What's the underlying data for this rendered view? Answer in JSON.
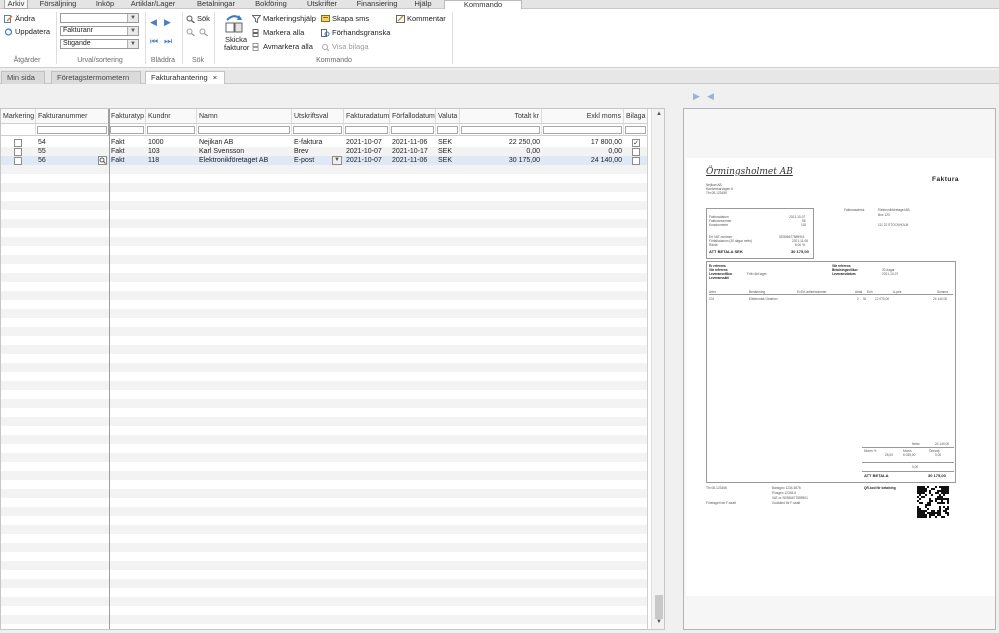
{
  "menu": {
    "tabs": [
      "Arkiv",
      "Försäljning",
      "Inköp",
      "Artiklar/Lager",
      "Betalningar",
      "Bokföring",
      "Utskrifter",
      "Finansiering",
      "Hjälp",
      "Kommando"
    ]
  },
  "ribbon": {
    "andra": "Ändra",
    "uppdatera": "Uppdatera",
    "atgarder_label": "Åtgärder",
    "combo_blank": "",
    "combo_sort": "Fakturanr",
    "combo_order": "Stigande",
    "urval_label": "Urval/sortering",
    "bladdra_label": "Bläddra",
    "sok": "Sök",
    "sok_label": "Sök",
    "skicka": "Skicka",
    "fakturor": "fakturor",
    "markeringshjalp": "Markeringshjälp",
    "markera_alla": "Markera alla",
    "avmarkera_alla": "Avmarkera alla",
    "skapa_sms": "Skapa sms",
    "forhandsgranska": "Förhandsgranska",
    "visa_bilaga": "Visa bilaga",
    "kommentar": "Kommentar",
    "kommando_label": "Kommando"
  },
  "doctabs": [
    "Min sida",
    "Företagstermometern",
    "Fakturahantering"
  ],
  "doctab_close": "×",
  "grid": {
    "columns": [
      "Markering",
      "Fakturanummer",
      "Fakturatyp",
      "Kundnr",
      "Namn",
      "Utskriftsval",
      "Fakturadatum",
      "Förfallodatum",
      "Valuta",
      "Totalt kr",
      "Exkl moms",
      "Bilaga"
    ],
    "rows": [
      {
        "nr": "54",
        "typ": "Fakt",
        "kundnr": "1000",
        "namn": "Nejikan AB",
        "utskrift": "E-faktura",
        "fdatum": "2021-10-07",
        "forfall": "2021-11-06",
        "valuta": "SEK",
        "totalt": "22 250,00",
        "exkl": "17 800,00",
        "bilaga": "✓"
      },
      {
        "nr": "55",
        "typ": "Fakt",
        "kundnr": "103",
        "namn": "Karl Svensson",
        "utskrift": "Brev",
        "fdatum": "2021-10-07",
        "forfall": "2021-10-17",
        "valuta": "SEK",
        "totalt": "0,00",
        "exkl": "0,00",
        "bilaga": ""
      },
      {
        "nr": "56",
        "typ": "Fakt",
        "kundnr": "118",
        "namn": "Elektronikföretaget AB",
        "utskrift": "E-post",
        "fdatum": "2021-10-07",
        "forfall": "2021-11-06",
        "valuta": "SEK",
        "totalt": "30 175,00",
        "exkl": "24 140,00",
        "bilaga": ""
      }
    ]
  },
  "preview": {
    "company_logo": "Örmingsholmet AB",
    "doc_title": "Faktura",
    "sender_lines": [
      "Nejikan AB",
      "Hantverkarvägen 6",
      "Tfn 08-123456"
    ],
    "box1": [
      [
        "Fakturadatum",
        "2021-10-07"
      ],
      [
        "Fakturanummer",
        "56"
      ],
      [
        "Kundnummer",
        "118"
      ]
    ],
    "box1b": [
      [
        "Ert VAT-nummer",
        "SE556677889901"
      ],
      [
        "Förfallodatum (30 dagar netto)",
        "2021-11-06"
      ],
      [
        "Ränta",
        "8,00 %"
      ]
    ],
    "att_betala": "ATT BETALA SEK",
    "att_betala_value": "30 175,00",
    "fakturaadress_label": "Fakturaadress",
    "fakturaadress": [
      "Elektronikföretaget AB",
      "Box 123",
      "111 22  STOCKHOLM"
    ],
    "refs_left": [
      [
        "Er referens",
        ""
      ],
      [
        "Vår referens",
        ""
      ],
      [
        "Leveransvillkor",
        "Fritt vårt lager"
      ],
      [
        "Leveranssätt",
        ""
      ]
    ],
    "refs_right": [
      [
        "Vår referens",
        ""
      ],
      [
        "Betalningsvillkor",
        "30 dagar"
      ],
      [
        "Leveransdatum",
        "2021-10-07"
      ]
    ],
    "item_headers": [
      "Artnr",
      "Benämning",
      "Ev.Ert artikelnummer",
      "Antal",
      "Enh",
      "A-pris",
      "Summa"
    ],
    "item": [
      "101",
      "Elektronisk Gearbox",
      "",
      "2",
      "St",
      "12 070,00",
      "24 140,00"
    ],
    "totals": [
      [
        "Netto",
        "24 140,00"
      ],
      [
        "Moms %",
        "25,00"
      ],
      [
        "Moms",
        "6 035,00"
      ],
      [
        "Öresutj.",
        "0,00"
      ]
    ],
    "total_label": "ATT BETALA",
    "total_value": "30 175,00",
    "footer_left": [
      "Tfn 08-123456",
      "",
      "Företaget har F-skatt"
    ],
    "footer_mid": [
      "Bankgiro 1234-5678",
      "Plusgiro 12345-6",
      "VAT-nr SE556677889901",
      "Godkänd för F-skatt"
    ],
    "footer_qr_label": "QR-kod för betalning"
  },
  "colors": {
    "accent": "#4a7fc8",
    "selected_row": "#dfe8f4"
  }
}
